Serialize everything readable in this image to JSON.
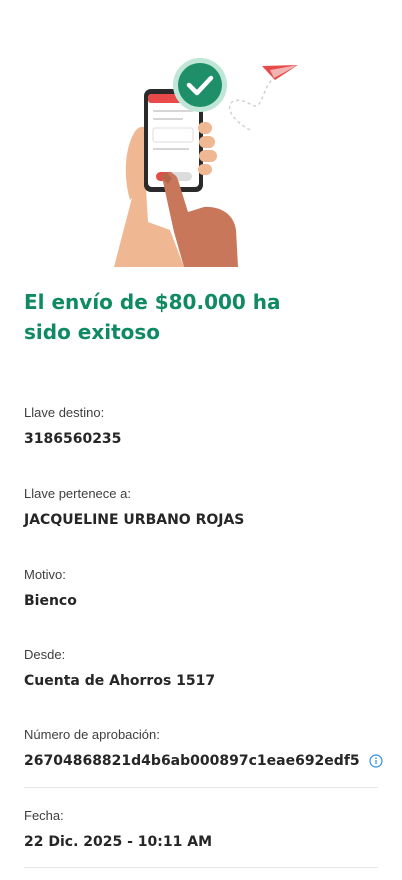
{
  "illustration": {
    "icon": "phone-payment-success-illustration",
    "check_color": "#1f8f6a",
    "plane_color": "#e84a4a"
  },
  "title": "El envío de $80.000 ha sido exitoso",
  "fields": [
    {
      "label": "Llave destino:",
      "value": "3186560235"
    },
    {
      "label": "Llave pertenece a:",
      "value": "JACQUELINE URBANO ROJAS"
    },
    {
      "label": "Motivo:",
      "value": "Bienco"
    },
    {
      "label": "Desde:",
      "value": "Cuenta de Ahorros 1517"
    },
    {
      "label": "Número de aprobación:",
      "value": "26704868821d4b6ab000897c1eae692edf5",
      "icon": "info-icon"
    },
    {
      "label": "Fecha:",
      "value": "22 Dic. 2025 - 10:11 AM"
    }
  ],
  "colors": {
    "title": "#0f8a62",
    "info_icon": "#2f8fe0"
  }
}
